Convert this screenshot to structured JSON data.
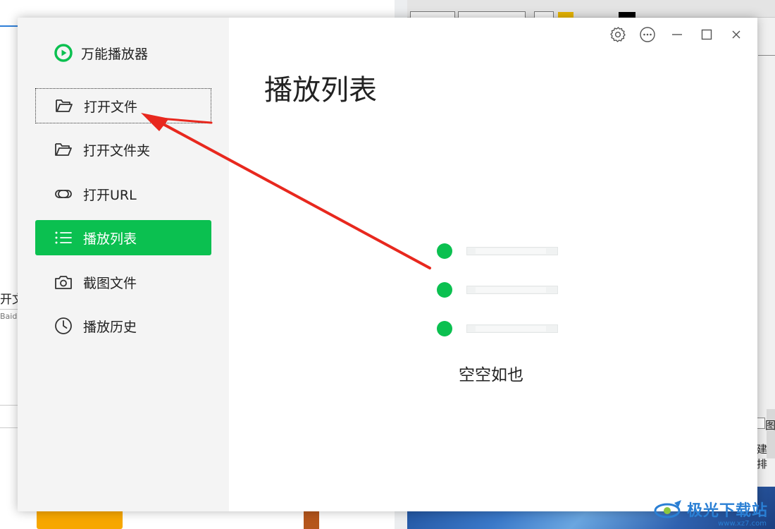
{
  "background": {
    "left_fragment_text": "开文",
    "left_fragment_small": "Baidu",
    "right_fragment_1": "图",
    "right_fragment_2": "建排",
    "watermark_text": "极光下载站",
    "watermark_url": "www.xz7.com"
  },
  "app": {
    "name": "万能播放器",
    "accent_color": "#0bc050"
  },
  "sidebar": {
    "items": [
      {
        "label": "打开文件",
        "icon": "folder-open-icon",
        "state": "focused"
      },
      {
        "label": "打开文件夹",
        "icon": "folder-open-icon",
        "state": "normal"
      },
      {
        "label": "打开URL",
        "icon": "link-icon",
        "state": "normal"
      },
      {
        "label": "播放列表",
        "icon": "list-icon",
        "state": "active"
      },
      {
        "label": "截图文件",
        "icon": "camera-icon",
        "state": "normal"
      },
      {
        "label": "播放历史",
        "icon": "clock-icon",
        "state": "normal"
      }
    ]
  },
  "main": {
    "title": "播放列表",
    "empty_text": "空空如也"
  },
  "window_controls": [
    "gear-icon",
    "more-icon",
    "minimize-icon",
    "maximize-icon",
    "close-icon"
  ],
  "annotation": {
    "arrow_color": "#e8281e",
    "arrow_target": "打开文件"
  }
}
